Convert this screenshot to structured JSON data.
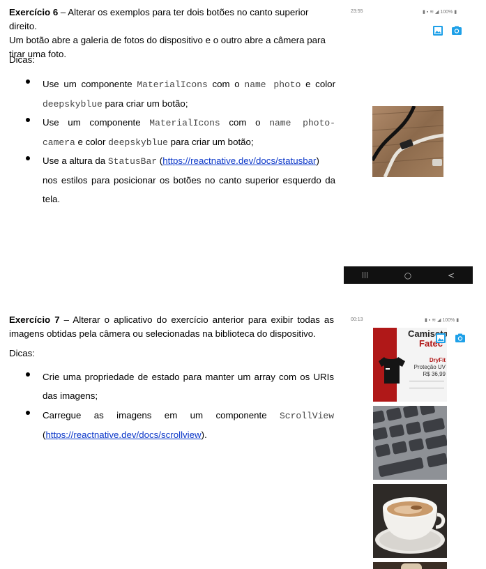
{
  "ex6": {
    "title": "Exercício 6",
    "intro_l1": " – Alterar os exemplos para ter dois botões no canto superior direito.",
    "intro_l2": "Um botão abre a galeria de fotos do dispositivo e o outro abre a câmera para",
    "intro_l3": "tirar uma foto.",
    "tips_label": "Dicas:",
    "b1_a": "Use um componente ",
    "b1_code1": "MaterialIcons",
    "b1_b": " com o ",
    "b1_code2": "name photo",
    "b1_c": " e color",
    "b1_code3": "deepskyblue",
    "b1_d": " para criar um botão;",
    "b2_a": "Use um componente ",
    "b2_code1": "MaterialIcons",
    "b2_b": " com o ",
    "b2_code2": "name photo-",
    "b2_code3": "camera",
    "b2_c": " e color ",
    "b2_code4": "deepskyblue",
    "b2_d": " para criar um botão;",
    "b3_a": "Use a altura da ",
    "b3_code": "StatusBar",
    "b3_link": "https://reactnative.dev/docs/statusbar",
    "b3_l2": "nos estilos para posicionar os botões no canto superior esquerdo da",
    "b3_l3": "tela.",
    "phone": {
      "time": "23:55",
      "battery": "100%",
      "nav_recent": "|||",
      "nav_home": "○",
      "nav_back": "<"
    }
  },
  "ex7": {
    "title": "Exercício 7",
    "intro_l1": " – Alterar o aplicativo do exercício anterior para exibir todas as",
    "intro_l2": "imagens obtidas pela câmera ou selecionadas na biblioteca do dispositivo.",
    "tips_label": "Dicas:",
    "b1_l1": "Crie uma propriedade de estado para manter um array com os URIs",
    "b1_l2": "das imagens;",
    "b2_a": "Carregue as imagens em um componente ",
    "b2_code": "ScrollView",
    "b2_link": "https://reactnative.dev/docs/scrollview",
    "b2_end": ").",
    "phone": {
      "time": "00:13",
      "battery": "100%",
      "shirt_title_l1": "Camiseta",
      "shirt_title_l2": "Fatec",
      "shirt_brand": "DryFit",
      "shirt_feature": "Proteção UV",
      "shirt_price": "R$ 36,99"
    }
  },
  "colors": {
    "icon": "#1ea0e8",
    "link": "#0b37c9"
  }
}
